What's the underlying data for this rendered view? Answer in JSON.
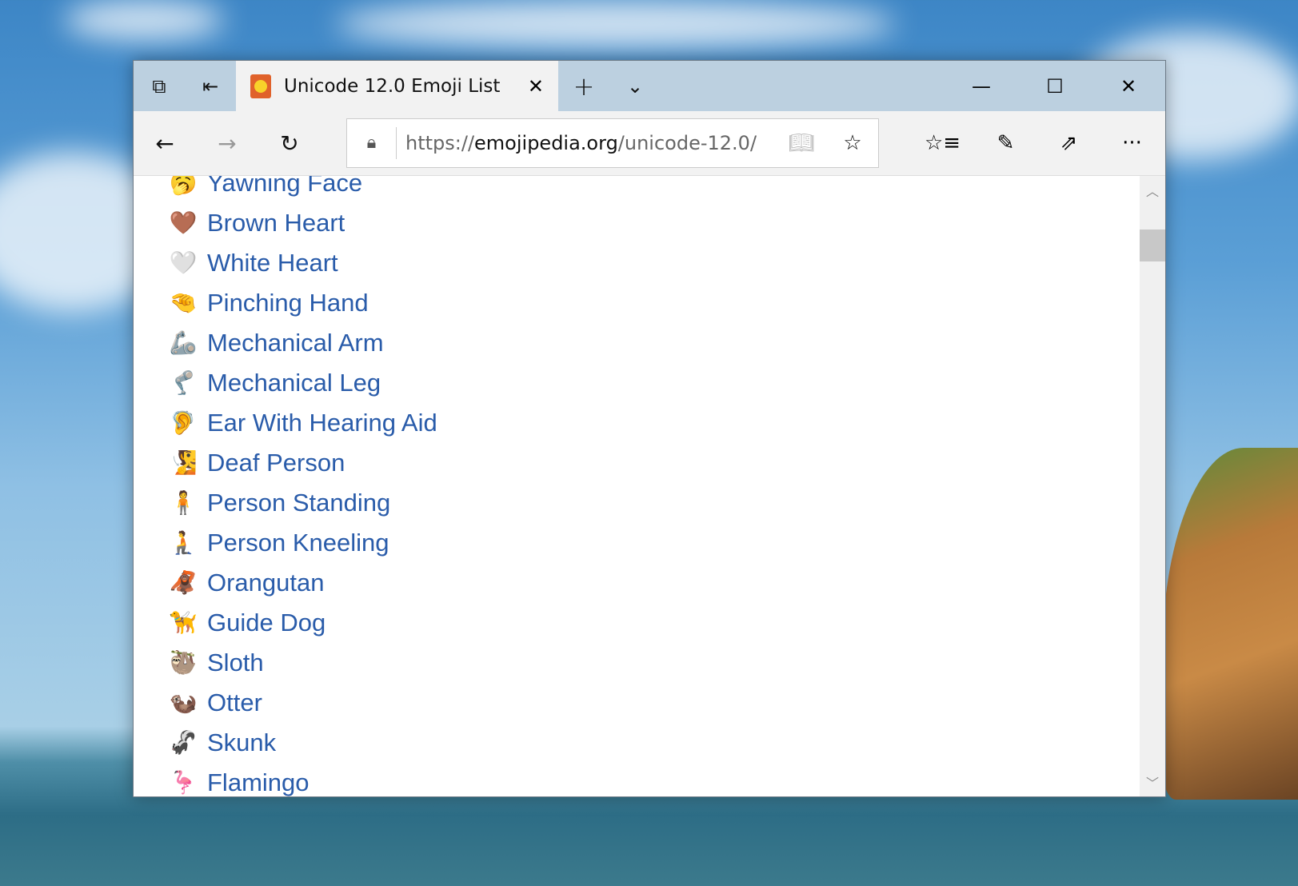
{
  "browser": {
    "tab_title": "Unicode 12.0 Emoji List",
    "url_prefix": "https://",
    "url_domain": "emojipedia.org",
    "url_path": "/unicode-12.0/"
  },
  "emoji_list": [
    {
      "name": "Yawning Face",
      "emoji": "🥱",
      "color": "#f5c33b"
    },
    {
      "name": "Brown Heart",
      "emoji": "🤎",
      "color": "#8a5a3a"
    },
    {
      "name": "White Heart",
      "emoji": "🤍",
      "color": "#ffffff"
    },
    {
      "name": "Pinching Hand",
      "emoji": "🤏",
      "color": "#f5c33b"
    },
    {
      "name": "Mechanical Arm",
      "emoji": "🦾",
      "color": "#9aa0a6"
    },
    {
      "name": "Mechanical Leg",
      "emoji": "🦿",
      "color": "#9aa0a6"
    },
    {
      "name": "Ear With Hearing Aid",
      "emoji": "🦻",
      "color": "#f5c33b"
    },
    {
      "name": "Deaf Person",
      "emoji": "🧏",
      "color": "#a95fc4"
    },
    {
      "name": "Person Standing",
      "emoji": "🧍",
      "color": "#2aa6a0"
    },
    {
      "name": "Person Kneeling",
      "emoji": "🧎",
      "color": "#2aa6a0"
    },
    {
      "name": "Orangutan",
      "emoji": "🦧",
      "color": "#d9541e"
    },
    {
      "name": "Guide Dog",
      "emoji": "🦮",
      "color": "#e0a040"
    },
    {
      "name": "Sloth",
      "emoji": "🦥",
      "color": "#a07050"
    },
    {
      "name": "Otter",
      "emoji": "🦦",
      "color": "#8a5a3a"
    },
    {
      "name": "Skunk",
      "emoji": "🦨",
      "color": "#333333"
    },
    {
      "name": "Flamingo",
      "emoji": "🦩",
      "color": "#f07090"
    }
  ],
  "colors": {
    "link": "#2a5caa",
    "tabbar": "#bcd0e0"
  }
}
